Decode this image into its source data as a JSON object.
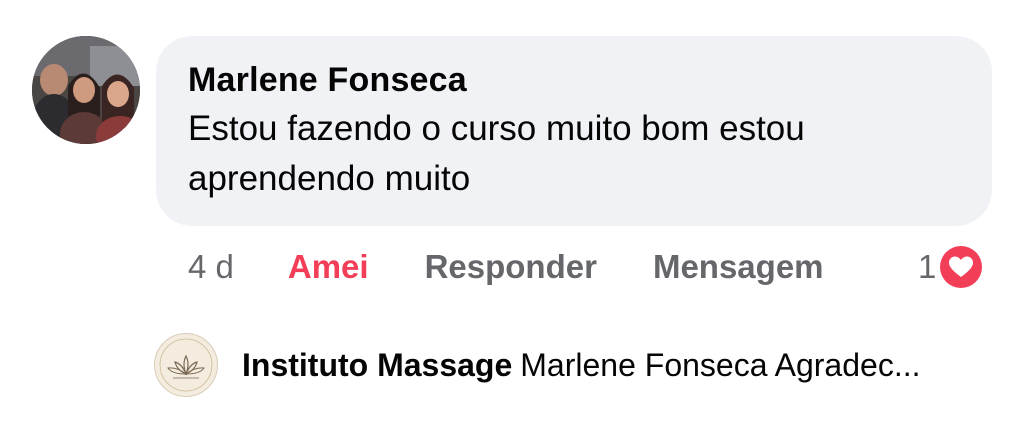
{
  "comment": {
    "author": "Marlene Fonseca",
    "text": "Estou fazendo o curso muito bom  estou aprendendo muito",
    "avatar_icon": "profile-photo-icon"
  },
  "actions": {
    "time": "4 d",
    "love_label": "Amei",
    "reply_label": "Responder",
    "message_label": "Mensagem"
  },
  "reactions": {
    "count": "1",
    "icon": "heart-icon",
    "color": "#f33e58"
  },
  "reply": {
    "author": "Instituto Massage",
    "preview": "Marlene Fonseca Agradec...",
    "avatar_icon": "lotus-logo-icon",
    "logo_text": "INSTITUTO MASSAGE"
  },
  "colors": {
    "bubble": "#f0f2f5",
    "text": "#050505",
    "muted": "#65676b",
    "love": "#f33e58"
  }
}
